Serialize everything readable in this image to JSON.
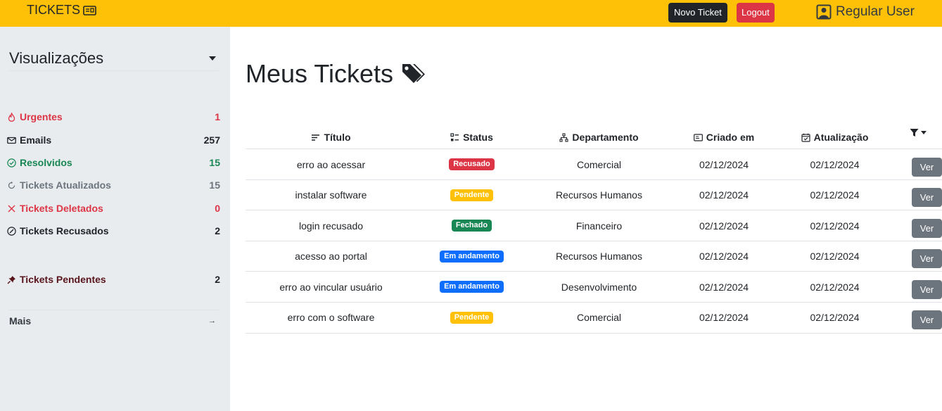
{
  "header": {
    "brand": "TICKETS",
    "new_ticket": "Novo Ticket",
    "logout": "Logout",
    "user": "Regular User",
    "colors": {
      "bar": "#ffc107",
      "dark_button": "#212529",
      "danger_button": "#dc3545"
    }
  },
  "sidebar": {
    "views_title": "Visualizações",
    "items": [
      {
        "label": "Urgentes",
        "count": "1",
        "icon": "fire-icon",
        "color": "#dc3545"
      },
      {
        "label": "Emails",
        "count": "257",
        "icon": "envelope-icon",
        "color": "#212529"
      },
      {
        "label": "Resolvidos",
        "count": "15",
        "icon": "check-circle-icon",
        "color": "#198754"
      },
      {
        "label": "Tickets Atualizados",
        "count": "15",
        "icon": "refresh-icon",
        "color": "#6c757d"
      },
      {
        "label": "Tickets Deletados",
        "count": "0",
        "icon": "x-icon",
        "color": "#dc3545"
      },
      {
        "label": "Tickets Recusados",
        "count": "2",
        "icon": "slash-circle-icon",
        "color": "#212529"
      },
      {
        "label": "Tickets Pendentes",
        "count": "2",
        "icon": "pin-icon",
        "color": "#58151c"
      }
    ],
    "more": "Mais",
    "more_arrow": "→"
  },
  "main": {
    "title": "Meus Tickets",
    "columns": [
      "Título",
      "Status",
      "Departamento",
      "Criado em",
      "Atualização"
    ],
    "view_label": "Ver",
    "rows": [
      {
        "title": "erro ao acessar",
        "status": "Recusado",
        "status_color": "#dc3545",
        "department": "Comercial",
        "created": "02/12/2024",
        "updated": "02/12/2024"
      },
      {
        "title": "instalar software",
        "status": "Pendente",
        "status_color": "#ffc107",
        "department": "Recursos Humanos",
        "created": "02/12/2024",
        "updated": "02/12/2024"
      },
      {
        "title": "login recusado",
        "status": "Fechado",
        "status_color": "#198754",
        "department": "Financeiro",
        "created": "02/12/2024",
        "updated": "02/12/2024"
      },
      {
        "title": "acesso ao portal",
        "status": "Em andamento",
        "status_color": "#0d6efd",
        "department": "Recursos Humanos",
        "created": "02/12/2024",
        "updated": "02/12/2024"
      },
      {
        "title": "erro ao vincular usuário",
        "status": "Em andamento",
        "status_color": "#0d6efd",
        "department": "Desenvolvimento",
        "created": "02/12/2024",
        "updated": "02/12/2024"
      },
      {
        "title": "erro com o software",
        "status": "Pendente",
        "status_color": "#ffc107",
        "department": "Comercial",
        "created": "02/12/2024",
        "updated": "02/12/2024"
      }
    ]
  }
}
